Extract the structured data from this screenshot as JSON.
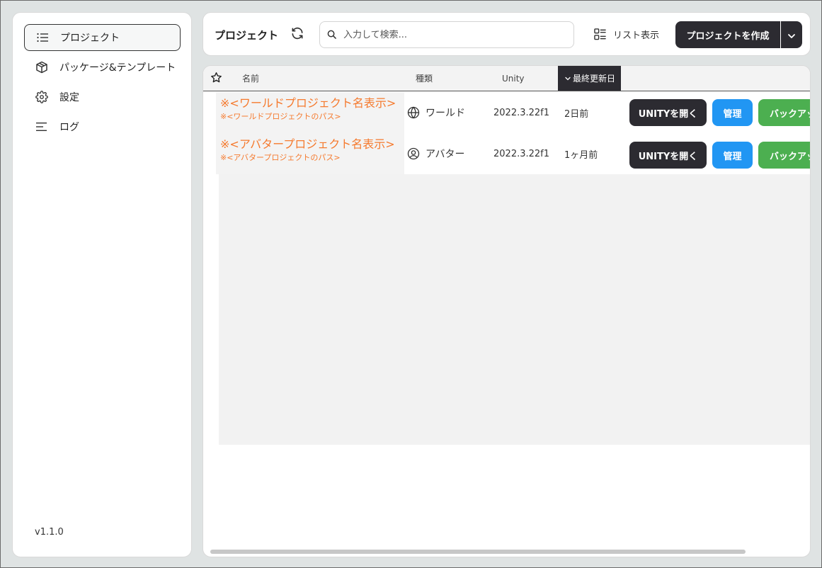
{
  "sidebar": {
    "items": [
      {
        "label": "プロジェクト",
        "icon": "list-icon"
      },
      {
        "label": "パッケージ&テンプレート",
        "icon": "package-icon"
      },
      {
        "label": "設定",
        "icon": "gear-icon"
      },
      {
        "label": "ログ",
        "icon": "log-icon"
      }
    ],
    "version": "v1.1.0"
  },
  "header": {
    "title": "プロジェクト",
    "search_placeholder": "入力して検索...",
    "list_view_label": "リスト表示",
    "create_label": "プロジェクトを作成"
  },
  "table": {
    "columns": {
      "name": "名前",
      "type": "種類",
      "unity": "Unity",
      "updated": "最終更新日"
    },
    "rows": [
      {
        "name": "※<ワールドプロジェクト名表示>",
        "path": "※<ワールドプロジェクトのパス>",
        "type": "ワールド",
        "type_icon": "globe-icon",
        "unity": "2022.3.22f1",
        "updated": "2日前",
        "open_label": "UNITYを開く",
        "manage_label": "管理",
        "backup_label": "バックアップ"
      },
      {
        "name": "※<アバタープロジェクト名表示>",
        "path": "※<アバタープロジェクトのパス>",
        "type": "アバター",
        "type_icon": "user-circle-icon",
        "unity": "2022.3.22f1",
        "updated": "1ヶ月前",
        "open_label": "UNITYを開く",
        "manage_label": "管理",
        "backup_label": "バックアップ"
      }
    ]
  },
  "colors": {
    "accent_dark": "#2c2b31",
    "manage_blue": "#2196f3",
    "backup_green": "#4caf50",
    "project_orange": "#f57a2e"
  }
}
